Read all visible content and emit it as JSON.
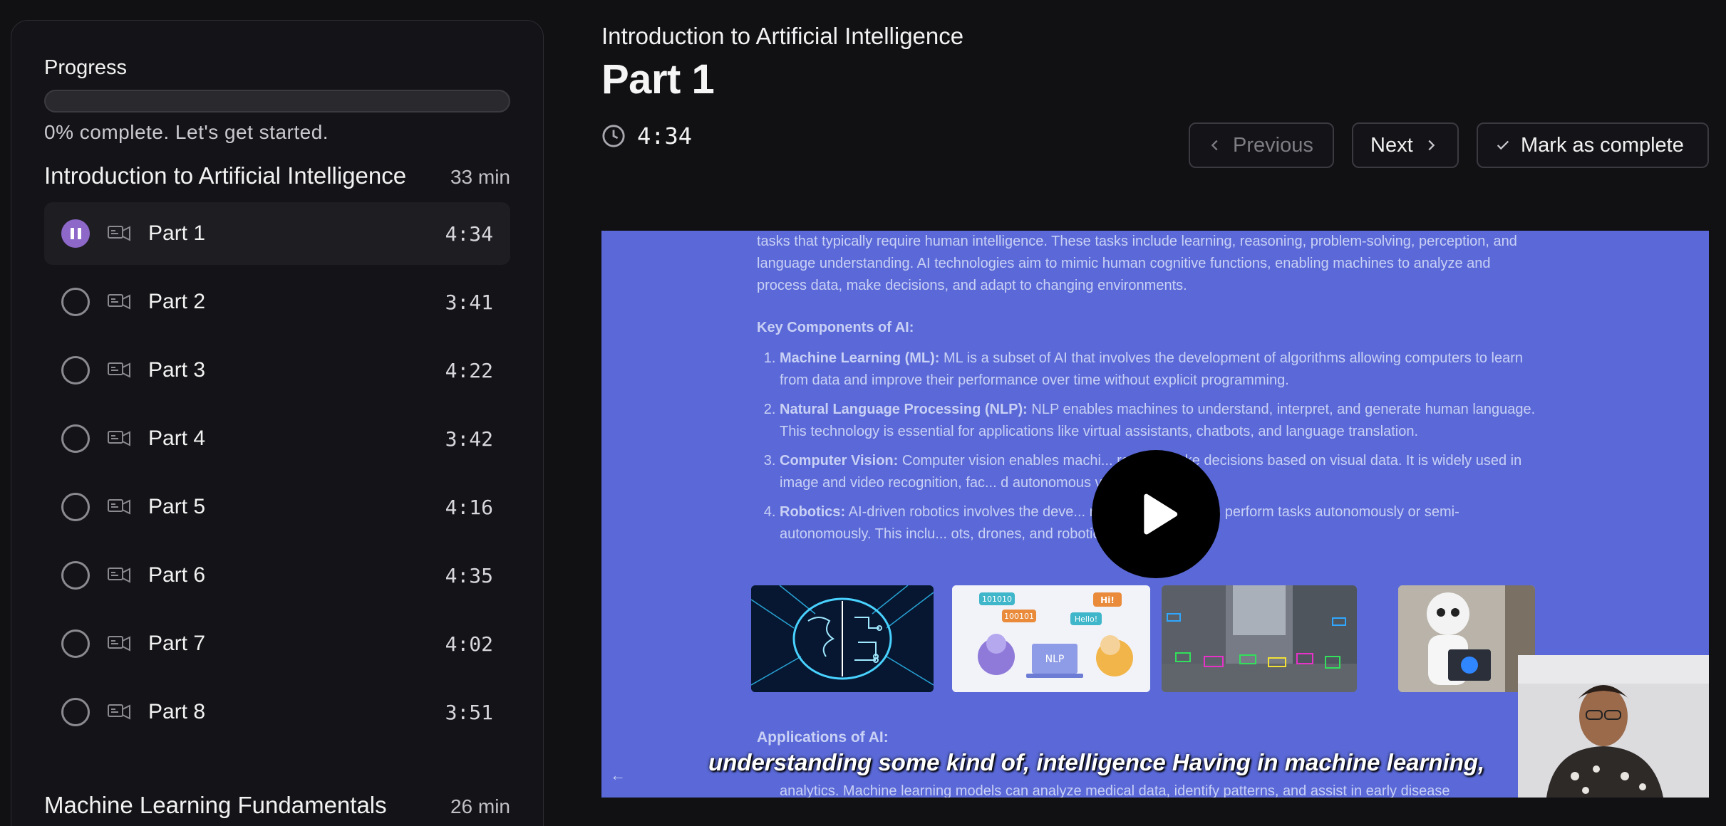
{
  "sidebar": {
    "progress_label": "Progress",
    "progress_percent": 0,
    "progress_text": "0% complete. Let's get started.",
    "sections": [
      {
        "title": "Introduction to Artificial Intelligence",
        "duration": "33 min",
        "lessons": [
          {
            "name": "Part 1",
            "time": "4:34",
            "active": true
          },
          {
            "name": "Part 2",
            "time": "3:41"
          },
          {
            "name": "Part 3",
            "time": "4:22"
          },
          {
            "name": "Part 4",
            "time": "3:42"
          },
          {
            "name": "Part 5",
            "time": "4:16"
          },
          {
            "name": "Part 6",
            "time": "4:35"
          },
          {
            "name": "Part 7",
            "time": "4:02"
          },
          {
            "name": "Part 8",
            "time": "3:51"
          }
        ]
      },
      {
        "title": "Machine Learning Fundamentals",
        "duration": "26 min"
      }
    ]
  },
  "main": {
    "course_title": "Introduction to Artificial Intelligence",
    "lesson_title": "Part 1",
    "duration": "4:34",
    "buttons": {
      "previous": "Previous",
      "next": "Next",
      "mark_complete": "Mark as complete"
    }
  },
  "video": {
    "slide_intro": "tasks that typically require human intelligence. These tasks include learning, reasoning, problem-solving, perception, and language understanding. AI technologies aim to mimic human cognitive functions, enabling machines to analyze and process data, make decisions, and adapt to changing environments.",
    "key_heading": "Key Components of AI:",
    "components": [
      {
        "term": "Machine Learning (ML):",
        "text": "ML is a subset of AI that involves the development of algorithms allowing computers to learn from data and improve their performance over time without explicit programming."
      },
      {
        "term": "Natural Language Processing (NLP):",
        "text": "NLP enables machines to understand, interpret, and generate human language. This technology is essential for applications like virtual assistants, chatbots, and language translation."
      },
      {
        "term": "Computer Vision:",
        "text": "Computer vision enables machi... ret and make decisions based on visual data. It is widely used in image and video recognition, fac... d autonomous vehicles."
      },
      {
        "term": "Robotics:",
        "text": "AI-driven robotics involves the deve... nt machines that can perform tasks autonomously or semi-autonomously. This inclu... ots, drones, and robotic assistants."
      }
    ],
    "applications_heading": "Applications of AI:",
    "bottom_line": "analytics. Machine learning models can analyze medical data, identify patterns, and assist in early disease",
    "caption": "understanding some kind of, intelligence Having in machine learning,",
    "thumb_nlp_tags": [
      "101010",
      "100101",
      "Hi!",
      "Hello!",
      "NLP"
    ],
    "colors": {
      "slide_bg": "#5a69d7",
      "accent": "#8d68c9"
    }
  }
}
